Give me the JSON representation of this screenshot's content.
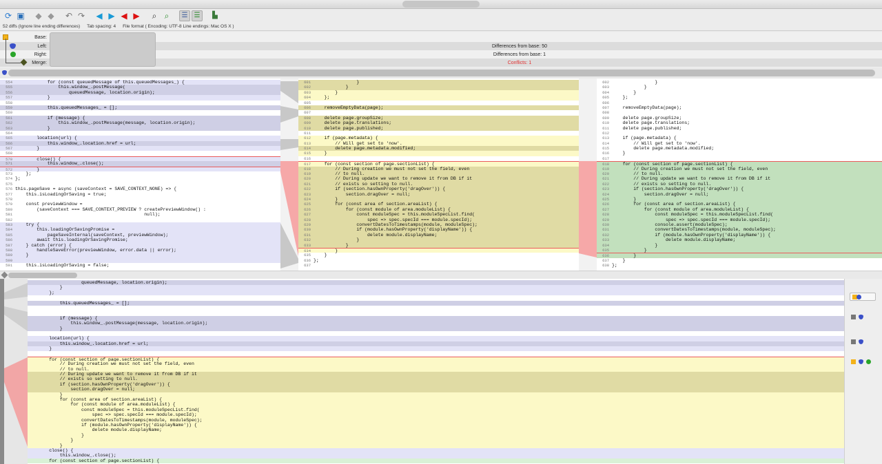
{
  "toolbar": {
    "icons": [
      "refresh-icon",
      "save-icon",
      "resolve-left-icon",
      "resolve-right-icon",
      "undo-icon",
      "redo-icon",
      "prev-diff-icon",
      "next-diff-icon",
      "prev-conflict-icon",
      "next-conflict-icon",
      "find-icon",
      "find-next-icon",
      "outline-icon",
      "merge-view-icon",
      "expand-icon"
    ]
  },
  "status": {
    "diffs": "52 diffs (Ignore line ending differences)",
    "tab": "Tab spacing: 4",
    "format": "File format ( Encoding: UTF-8  Line endings: Mac OS X )"
  },
  "header": {
    "base_label": "Base:",
    "left_label": "Left:",
    "right_label": "Right:",
    "merge_label": "Merge:",
    "left_value": "Differences from base: 50",
    "right_value": "Differences from base: 1",
    "merge_value": "Conflicts: 1"
  },
  "colors": {
    "conflict": "#e84040",
    "left_change": "#cfcfe5",
    "base": "#fcf9c7",
    "right_change": "#c2e0bd"
  },
  "left_pane": [
    {
      "n": "554",
      "c": "            for (const queuedMessage of this.queuedMessages_) {",
      "k": "diff"
    },
    {
      "n": "555",
      "c": "                this.window_.postMessage(",
      "k": "chg"
    },
    {
      "n": "556",
      "c": "                    queuedMessage, location.origin);",
      "k": "chg"
    },
    {
      "n": "557",
      "c": "            }",
      "k": "diff"
    },
    {
      "n": "558",
      "c": "",
      "k": ""
    },
    {
      "n": "559",
      "c": "            this.queuedMessages_ = [];",
      "k": "chg"
    },
    {
      "n": "560",
      "c": "",
      "k": ""
    },
    {
      "n": "561",
      "c": "            if (message) {",
      "k": "chg"
    },
    {
      "n": "562",
      "c": "                this.window_.postMessage(message, location.origin);",
      "k": "chg"
    },
    {
      "n": "563",
      "c": "            }",
      "k": "chg"
    },
    {
      "n": "564",
      "c": "",
      "k": ""
    },
    {
      "n": "565",
      "c": "        location(url) {",
      "k": "diff"
    },
    {
      "n": "566",
      "c": "            this.window_.location.href = url;",
      "k": "chg"
    },
    {
      "n": "567",
      "c": "        }",
      "k": "diff"
    },
    {
      "n": "568",
      "c": "",
      "k": ""
    },
    {
      "n": "570",
      "c": "        close() {",
      "k": "diff conf"
    },
    {
      "n": "571",
      "c": "            this.window_.close();",
      "k": "chg"
    },
    {
      "n": "572",
      "c": "        }",
      "k": "diff conf"
    },
    {
      "n": "573",
      "c": "    };",
      "k": ""
    },
    {
      "n": "574",
      "c": "};",
      "k": ""
    },
    {
      "n": "575",
      "c": "",
      "k": ""
    },
    {
      "n": "576",
      "c": "this.pageSave = async (saveContext = SAVE_CONTEXT_NONE) => {",
      "k": ""
    },
    {
      "n": "577",
      "c": "    this.isLoadingOrSaving = true;",
      "k": ""
    },
    {
      "n": "578",
      "c": "",
      "k": ""
    },
    {
      "n": "579",
      "c": "    const previewWindow =",
      "k": ""
    },
    {
      "n": "580",
      "c": "        (saveContext === SAVE_CONTEXT_PREVIEW ? createPreviewWindow() :",
      "k": ""
    },
    {
      "n": "581",
      "c": "                                                null);",
      "k": ""
    },
    {
      "n": "582",
      "c": "",
      "k": ""
    },
    {
      "n": "583",
      "c": "    try {",
      "k": "diff"
    },
    {
      "n": "584",
      "c": "        this.loadingOrSavingPromise =",
      "k": "diff"
    },
    {
      "n": "585",
      "c": "            pageSaveInternal(saveContext, previewWindow);",
      "k": "diff"
    },
    {
      "n": "586",
      "c": "        await this.loadingOrSavingPromise;",
      "k": "diff"
    },
    {
      "n": "587",
      "c": "    } catch (error) {",
      "k": "diff"
    },
    {
      "n": "588",
      "c": "        handleSaveError(previewWindow, error.data || error);",
      "k": "diff"
    },
    {
      "n": "589",
      "c": "    }",
      "k": "diff"
    },
    {
      "n": "590",
      "c": "",
      "k": "diff"
    },
    {
      "n": "591",
      "c": "    this.isLoadingOrSaving = false;",
      "k": ""
    }
  ],
  "base_pane": [
    {
      "n": "601",
      "c": "                }",
      "k": "yelchg"
    },
    {
      "n": "602",
      "c": "            }",
      "k": "yelchg"
    },
    {
      "n": "603",
      "c": "        }",
      "k": "yel"
    },
    {
      "n": "604",
      "c": "    };",
      "k": "yel"
    },
    {
      "n": "605",
      "c": "",
      "k": ""
    },
    {
      "n": "606",
      "c": "    removeEmptyData(page);",
      "k": "yelchg"
    },
    {
      "n": "607",
      "c": "",
      "k": ""
    },
    {
      "n": "608",
      "c": "    delete page.groupSize;",
      "k": "yelchg"
    },
    {
      "n": "609",
      "c": "    delete page.translations;",
      "k": "yelchg"
    },
    {
      "n": "610",
      "c": "    delete page.published;",
      "k": "yelchg"
    },
    {
      "n": "611",
      "c": "",
      "k": ""
    },
    {
      "n": "612",
      "c": "    if (page.metadata) {",
      "k": "yel"
    },
    {
      "n": "613",
      "c": "        // Will get set to 'now'.",
      "k": "yel"
    },
    {
      "n": "614",
      "c": "        delete page.metadata.modified;",
      "k": "yelchg"
    },
    {
      "n": "615",
      "c": "    }",
      "k": "yel"
    },
    {
      "n": "616",
      "c": "",
      "k": ""
    },
    {
      "n": "617",
      "c": "    for (const section of page.sectionList) {",
      "k": "yel conf"
    },
    {
      "n": "618",
      "c": "        // During creation we must not set the field, even",
      "k": "yelchg"
    },
    {
      "n": "619",
      "c": "        // to null.",
      "k": "yelchg"
    },
    {
      "n": "620",
      "c": "        // During update we want to remove it from DB if it",
      "k": "yelchg"
    },
    {
      "n": "621",
      "c": "        // exists so setting to null.",
      "k": "yelchg"
    },
    {
      "n": "622",
      "c": "        if (section.hasOwnProperty('dragOver')) {",
      "k": "yelchg"
    },
    {
      "n": "623",
      "c": "            section.dragOver = null;",
      "k": "yelchg"
    },
    {
      "n": "624",
      "c": "        }",
      "k": "yelchg"
    },
    {
      "n": "625",
      "c": "        for (const area of section.areaList) {",
      "k": "yelchg"
    },
    {
      "n": "626",
      "c": "            for (const module of area.moduleList) {",
      "k": "yelchg"
    },
    {
      "n": "627",
      "c": "                const moduleSpec = this.moduleSpecList.find(",
      "k": "yelchg"
    },
    {
      "n": "628",
      "c": "                    spec => spec.specId === module.specId);",
      "k": "yelchg"
    },
    {
      "n": "629",
      "c": "                convertDatesToTimestamps(module, moduleSpec);",
      "k": "yelchg"
    },
    {
      "n": "630",
      "c": "                if (module.hasOwnProperty('displayName')) {",
      "k": "yelchg"
    },
    {
      "n": "631",
      "c": "                    delete module.displayName;",
      "k": "yelchg"
    },
    {
      "n": "632",
      "c": "                }",
      "k": "yelchg"
    },
    {
      "n": "633",
      "c": "            }",
      "k": "yelchg"
    },
    {
      "n": "634",
      "c": "        }",
      "k": "yel conf"
    },
    {
      "n": "635",
      "c": "    }",
      "k": ""
    },
    {
      "n": "636",
      "c": "};",
      "k": ""
    },
    {
      "n": "637",
      "c": "",
      "k": ""
    }
  ],
  "right_pane": [
    {
      "n": "602",
      "c": "                }",
      "k": ""
    },
    {
      "n": "603",
      "c": "            }",
      "k": ""
    },
    {
      "n": "604",
      "c": "        }",
      "k": ""
    },
    {
      "n": "605",
      "c": "    };",
      "k": ""
    },
    {
      "n": "606",
      "c": "",
      "k": ""
    },
    {
      "n": "607",
      "c": "    removeEmptyData(page);",
      "k": ""
    },
    {
      "n": "608",
      "c": "",
      "k": ""
    },
    {
      "n": "609",
      "c": "    delete page.groupSize;",
      "k": ""
    },
    {
      "n": "610",
      "c": "    delete page.translations;",
      "k": ""
    },
    {
      "n": "611",
      "c": "    delete page.published;",
      "k": ""
    },
    {
      "n": "612",
      "c": "",
      "k": ""
    },
    {
      "n": "613",
      "c": "    if (page.metadata) {",
      "k": ""
    },
    {
      "n": "614",
      "c": "        // Will get set to 'now'.",
      "k": ""
    },
    {
      "n": "615",
      "c": "        delete page.metadata.modified;",
      "k": ""
    },
    {
      "n": "616",
      "c": "    }",
      "k": ""
    },
    {
      "n": "617",
      "c": "",
      "k": ""
    },
    {
      "n": "618",
      "c": "    for (const section of page.sectionList) {",
      "k": "grnchg conf"
    },
    {
      "n": "619",
      "c": "        // During creation we must not set the field, even",
      "k": "grnchg"
    },
    {
      "n": "620",
      "c": "        // to null.",
      "k": "grnchg"
    },
    {
      "n": "621",
      "c": "        // During update we want to remove it from DB if it",
      "k": "grnchg"
    },
    {
      "n": "622",
      "c": "        // exists so setting to null.",
      "k": "grnchg"
    },
    {
      "n": "623",
      "c": "        if (section.hasOwnProperty('dragOver')) {",
      "k": "grnchg"
    },
    {
      "n": "624",
      "c": "            section.dragOver = null;",
      "k": "grnchg"
    },
    {
      "n": "625",
      "c": "        }",
      "k": "grnchg"
    },
    {
      "n": "626",
      "c": "        for (const area of section.areaList) {",
      "k": "grnchg"
    },
    {
      "n": "627",
      "c": "            for (const module of area.moduleList) {",
      "k": "grnchg"
    },
    {
      "n": "628",
      "c": "                const moduleSpec = this.moduleSpecList.find(",
      "k": "grnchg"
    },
    {
      "n": "629",
      "c": "                    spec => spec.specId === module.specId);",
      "k": "grnchg"
    },
    {
      "n": "630",
      "c": "                console.assert(moduleSpec);",
      "k": "grnchg"
    },
    {
      "n": "631",
      "c": "                convertDatesToTimestamps(module, moduleSpec);",
      "k": "grnchg"
    },
    {
      "n": "632",
      "c": "                if (module.hasOwnProperty('displayName')) {",
      "k": "grnchg"
    },
    {
      "n": "633",
      "c": "                    delete module.displayName;",
      "k": "grnchg"
    },
    {
      "n": "634",
      "c": "                }",
      "k": "grnchg"
    },
    {
      "n": "635",
      "c": "            }",
      "k": "grnchg"
    },
    {
      "n": "636",
      "c": "        }",
      "k": "grnchg conf"
    },
    {
      "n": "637",
      "c": "    }",
      "k": ""
    },
    {
      "n": "638",
      "c": "};",
      "k": ""
    }
  ],
  "merge_pane": [
    {
      "c": "                    queuedMessage, location.origin);",
      "k": "chg"
    },
    {
      "c": "            }",
      "k": "diff"
    },
    {
      "c": "        };",
      "k": "diff"
    },
    {
      "c": "",
      "k": ""
    },
    {
      "c": "            this.queuedMessages_ = [];",
      "k": "chg"
    },
    {
      "c": "",
      "k": ""
    },
    {
      "c": "",
      "k": ""
    },
    {
      "c": "            if (message) {",
      "k": "chg"
    },
    {
      "c": "                this.window_.postMessage(message, location.origin);",
      "k": "chg"
    },
    {
      "c": "            }",
      "k": "chg"
    },
    {
      "c": "",
      "k": ""
    },
    {
      "c": "        location(url) {",
      "k": "diff"
    },
    {
      "c": "            this.window_.location.href = url;",
      "k": "chg"
    },
    {
      "c": "        }",
      "k": "diff"
    },
    {
      "c": "",
      "k": ""
    },
    {
      "c": "        for (const section of page.sectionList) {",
      "k": "yel conf"
    },
    {
      "c": "            // During creation we must not set the field, even",
      "k": "yel"
    },
    {
      "c": "            // to null.",
      "k": "yel"
    },
    {
      "c": "            // During update we want to remove it from DB if it",
      "k": "yelchg"
    },
    {
      "c": "            // exists so setting to null.",
      "k": "yelchg"
    },
    {
      "c": "            if (section.hasOwnProperty('dragOver')) {",
      "k": "yelchg"
    },
    {
      "c": "                section.dragOver = null;",
      "k": "yelchg"
    },
    {
      "c": "            }",
      "k": "yel"
    },
    {
      "c": "            for (const area of section.areaList) {",
      "k": "yel"
    },
    {
      "c": "                for (const module of area.moduleList) {",
      "k": "yel"
    },
    {
      "c": "                    const moduleSpec = this.moduleSpecList.find(",
      "k": "yel"
    },
    {
      "c": "                        spec => spec.specId === module.specId);",
      "k": "yel"
    },
    {
      "c": "                    convertDatesToTimestamps(module, moduleSpec);",
      "k": "yel"
    },
    {
      "c": "                    if (module.hasOwnProperty('displayName')) {",
      "k": "yel"
    },
    {
      "c": "                        delete module.displayName;",
      "k": "yel"
    },
    {
      "c": "                    }",
      "k": "yel"
    },
    {
      "c": "                }",
      "k": "yel"
    },
    {
      "c": "            }",
      "k": "yel"
    },
    {
      "c": "        close() {",
      "k": "diff"
    },
    {
      "c": "            this.window_.close();",
      "k": "diff"
    },
    {
      "c": "        for (const section of page.sectionList) {",
      "k": "grn"
    }
  ]
}
